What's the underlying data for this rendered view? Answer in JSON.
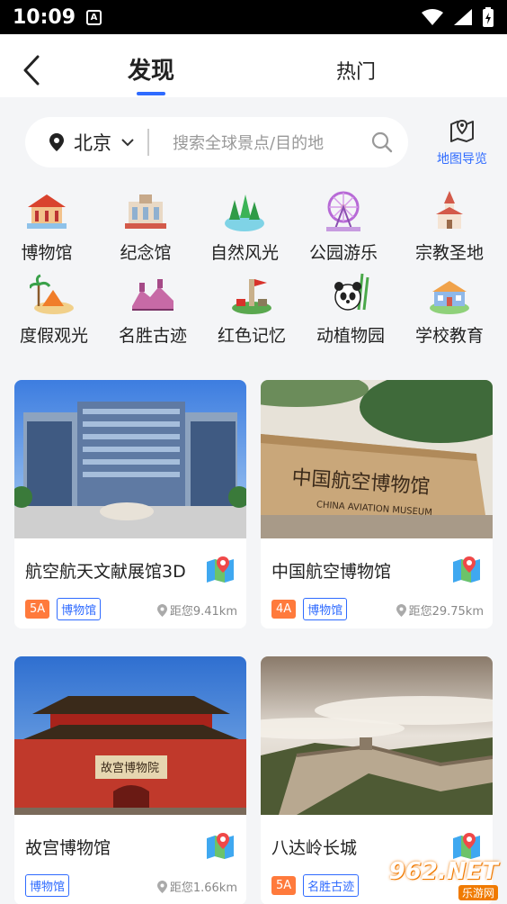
{
  "status_bar": {
    "time": "10:09",
    "notif": "A"
  },
  "nav": {
    "tab_discover": "发现",
    "tab_hot": "热门"
  },
  "search": {
    "city": "北京",
    "placeholder": "搜索全球景点/目的地",
    "map_nav_label": "地图导览"
  },
  "categories": [
    {
      "label": "博物馆",
      "icon": "museum-icon"
    },
    {
      "label": "纪念馆",
      "icon": "memorial-hall-icon"
    },
    {
      "label": "自然风光",
      "icon": "nature-icon"
    },
    {
      "label": "公园游乐",
      "icon": "ferris-wheel-icon"
    },
    {
      "label": "宗教圣地",
      "icon": "church-icon"
    },
    {
      "label": "度假观光",
      "icon": "beach-resort-icon"
    },
    {
      "label": "名胜古迹",
      "icon": "great-wall-icon"
    },
    {
      "label": "红色记忆",
      "icon": "red-memory-icon"
    },
    {
      "label": "动植物园",
      "icon": "panda-icon"
    },
    {
      "label": "学校教育",
      "icon": "school-icon"
    }
  ],
  "cards": [
    {
      "title": "航空航天文献展馆3D",
      "level": "5A",
      "category": "博物馆",
      "distance": "距您9.41km",
      "image": "modern-building-photo"
    },
    {
      "title": "中国航空博物馆",
      "level": "4A",
      "category": "博物馆",
      "distance": "距您29.75km",
      "image": "aviation-museum-wall-photo",
      "image_text": "中国航空博物馆",
      "image_text_en": "CHINA AVIATION MUSEUM"
    },
    {
      "title": "故宫博物馆",
      "level": "",
      "category": "博物馆",
      "distance": "距您1.66km",
      "image": "forbidden-city-gate-photo",
      "image_text": "故宫博物院"
    },
    {
      "title": "八达岭长城",
      "level": "5A",
      "category": "名胜古迹",
      "distance": "",
      "image": "great-wall-photo"
    }
  ],
  "watermark": {
    "big": "962.NET",
    "small": "乐游网"
  },
  "colors": {
    "accent": "#2f6bff",
    "level_badge": "#ff7a3c"
  }
}
